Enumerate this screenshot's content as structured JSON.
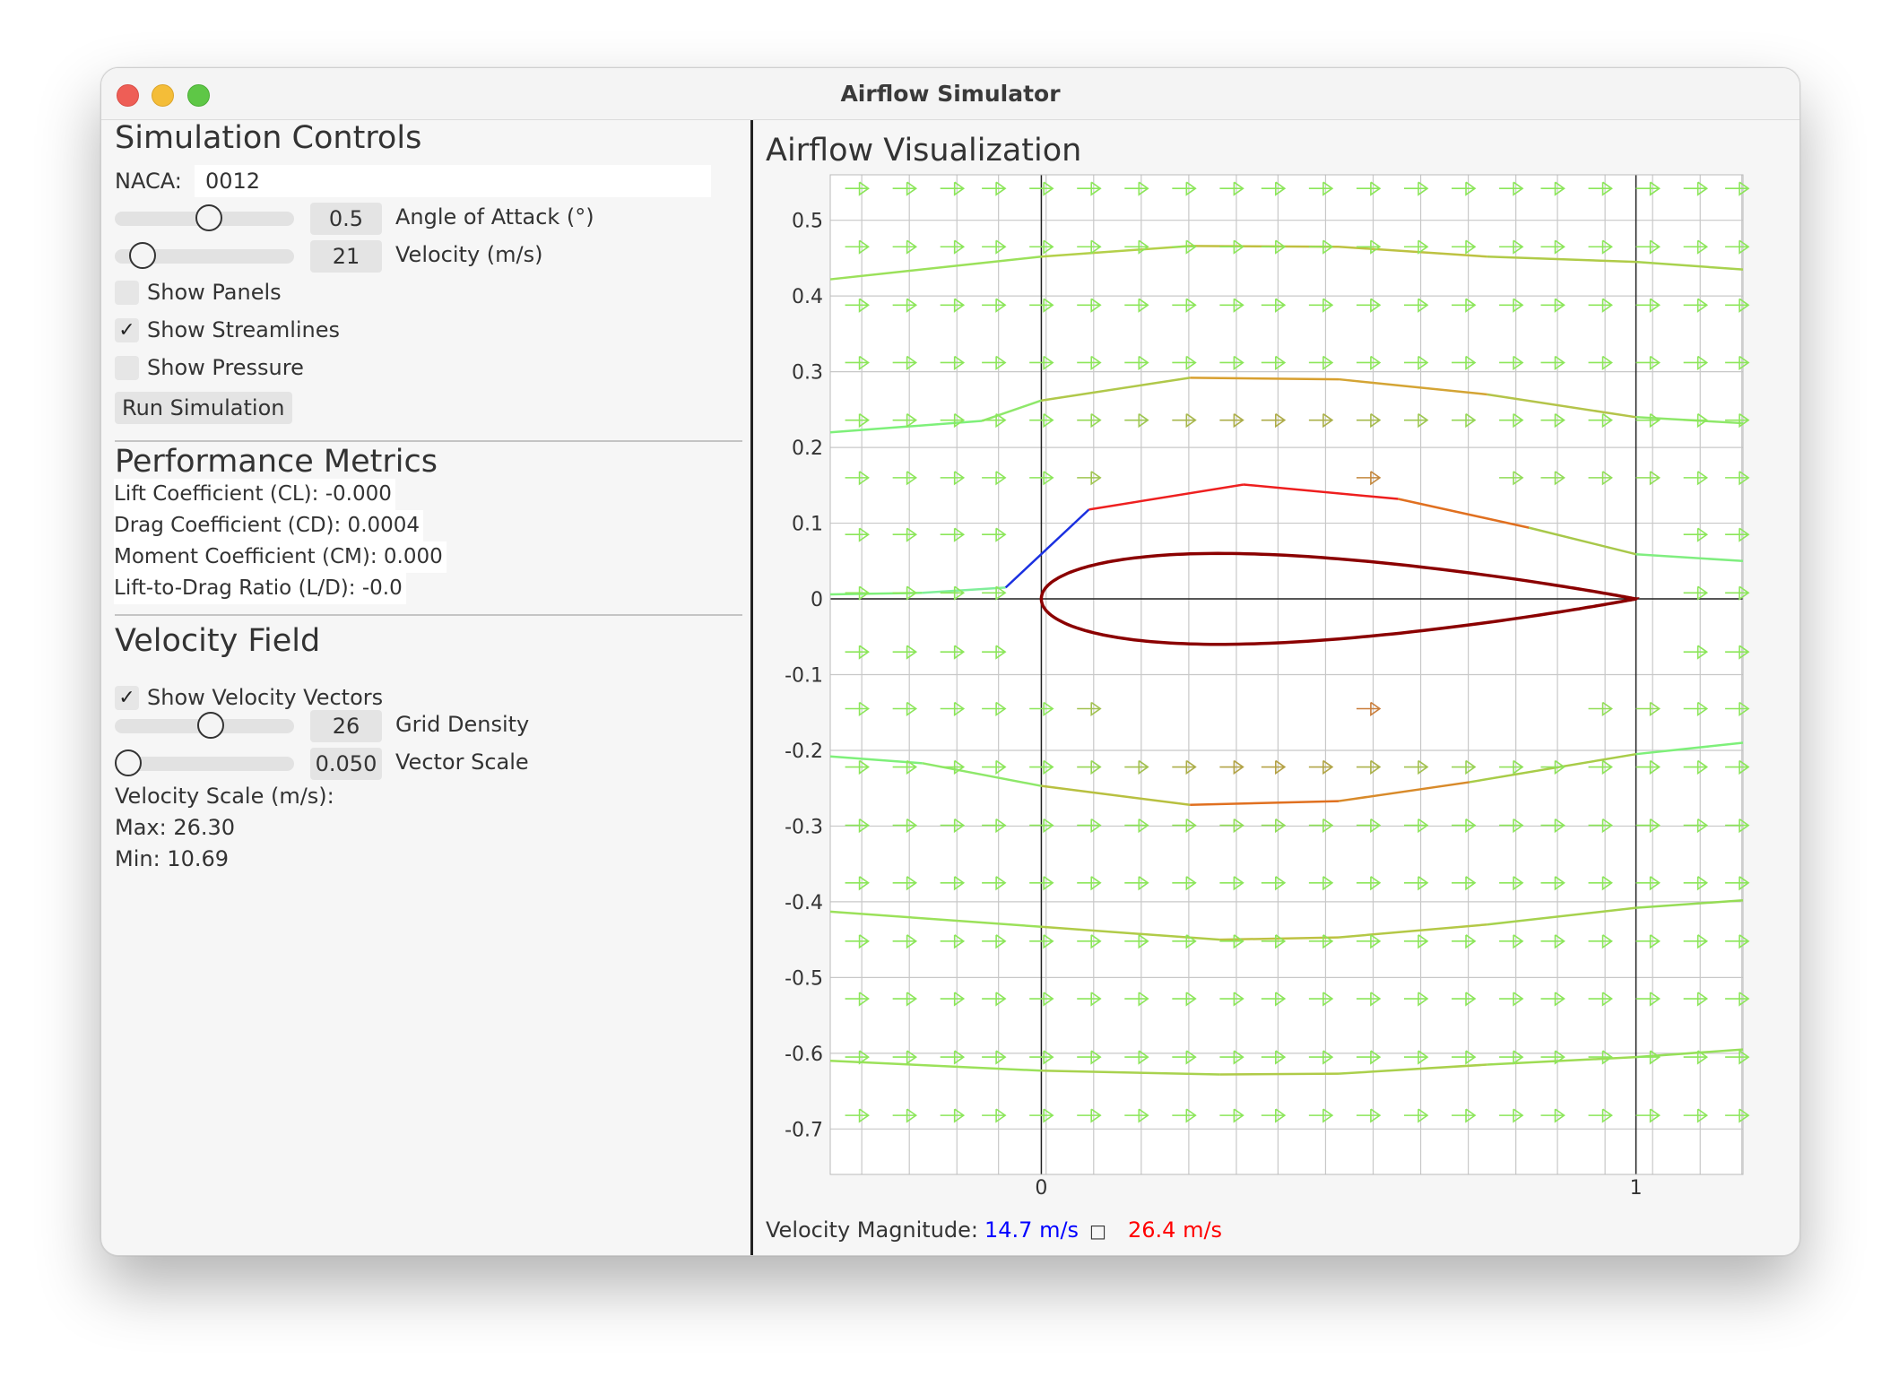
{
  "window": {
    "title": "Airflow Simulator"
  },
  "controls": {
    "heading": "Simulation Controls",
    "naca_label": "NACA:",
    "naca_value": "0012",
    "aoa": {
      "value": "0.5",
      "label": "Angle of Attack (°)",
      "slider_fraction": 0.52
    },
    "velocity": {
      "value": "21",
      "label": "Velocity (m/s)",
      "slider_fraction": 0.16
    },
    "show_panels": {
      "label": "Show Panels",
      "checked": false,
      "mark": ""
    },
    "show_streamlines": {
      "label": "Show Streamlines",
      "checked": true,
      "mark": "✓"
    },
    "show_pressure": {
      "label": "Show Pressure",
      "checked": false,
      "mark": ""
    },
    "run_button": "Run Simulation"
  },
  "metrics": {
    "heading": "Performance Metrics",
    "lift": "Lift Coefficient (CL): -0.000",
    "drag": "Drag Coefficient (CD): 0.0004",
    "moment": "Moment Coefficient (CM): 0.000",
    "ld": "Lift-to-Drag Ratio (L/D): -0.0"
  },
  "velocity_field": {
    "heading": "Velocity Field",
    "show_vectors": {
      "label": "Show Velocity Vectors",
      "checked": true,
      "mark": "✓"
    },
    "grid_density": {
      "value": "26",
      "label": "Grid Density",
      "slider_fraction": 0.53
    },
    "vector_scale": {
      "value": "0.050",
      "label": "Vector Scale",
      "slider_fraction": 0.0
    },
    "scale_label": "Velocity Scale (m/s):",
    "max": "Max: 26.30",
    "min": "Min: 10.69"
  },
  "visualization": {
    "heading": "Airflow Visualization",
    "legend_label": "Velocity Magnitude:",
    "legend_low": "14.7 m/s",
    "legend_square": "□",
    "legend_high": "26.4 m/s",
    "colors": {
      "low": "#0000ff",
      "high": "#ff0000",
      "airfoil": "#8b0000"
    }
  },
  "chart_data": {
    "type": "line",
    "title": "",
    "xlabel": "",
    "ylabel": "",
    "xlim": [
      -0.355,
      1.18
    ],
    "ylim": [
      -0.76,
      0.56
    ],
    "x_ticks": [
      0,
      1
    ],
    "x_tick_labels": [
      "0",
      "1"
    ],
    "y_ticks": [
      0.5,
      0.4,
      0.3,
      0.2,
      0.1,
      0,
      -0.1,
      -0.2,
      -0.3,
      -0.4,
      -0.5,
      -0.6,
      -0.7
    ],
    "y_tick_labels": [
      "0.5",
      "0.4",
      "0.3",
      "0.2",
      "0.1",
      "0",
      "-0.1",
      "-0.2",
      "-0.3",
      "-0.4",
      "-0.5",
      "-0.6",
      "-0.7"
    ],
    "grid": true,
    "airfoil": {
      "name": "NACA 0012",
      "chord": 1,
      "thickness": 0.12
    },
    "streamlines": [
      {
        "points": [
          [
            -0.355,
            0.422
          ],
          [
            0,
            0.452
          ],
          [
            0.25,
            0.466
          ],
          [
            0.5,
            0.465
          ],
          [
            0.75,
            0.452
          ],
          [
            1.0,
            0.445
          ],
          [
            1.18,
            0.435
          ]
        ],
        "colors": [
          "#9be15a",
          "#b4d04a",
          "#c0c040",
          "#bdc242",
          "#b0cb48",
          "#a8d24e"
        ]
      },
      {
        "points": [
          [
            -0.355,
            0.22
          ],
          [
            -0.1,
            0.235
          ],
          [
            0,
            0.262
          ],
          [
            0.25,
            0.292
          ],
          [
            0.5,
            0.29
          ],
          [
            0.75,
            0.27
          ],
          [
            1.0,
            0.24
          ],
          [
            1.18,
            0.232
          ]
        ],
        "colors": [
          "#7ef07a",
          "#8ee86a",
          "#b0c84a",
          "#d8a030",
          "#d4a434",
          "#b4c44a",
          "#8ee86a"
        ]
      },
      {
        "points": [
          [
            -0.355,
            0.006
          ],
          [
            -0.2,
            0.008
          ],
          [
            -0.06,
            0.015
          ],
          [
            0.08,
            0.118
          ],
          [
            0.34,
            0.151
          ],
          [
            0.6,
            0.132
          ],
          [
            0.82,
            0.094
          ],
          [
            1.0,
            0.059
          ],
          [
            1.18,
            0.05
          ]
        ],
        "colors": [
          "#7ef07a",
          "#80ee9a",
          "#1a30e0",
          "#ee2020",
          "#ee1e1e",
          "#e07020",
          "#a8c84a",
          "#80ee80"
        ]
      },
      {
        "points": [
          [
            -0.355,
            -0.208
          ],
          [
            -0.2,
            -0.217
          ],
          [
            0,
            -0.247
          ],
          [
            0.25,
            -0.272
          ],
          [
            0.5,
            -0.267
          ],
          [
            0.72,
            -0.242
          ],
          [
            1.0,
            -0.205
          ],
          [
            1.18,
            -0.19
          ]
        ],
        "colors": [
          "#7ef07a",
          "#8ee86a",
          "#b8c040",
          "#e07020",
          "#d88a2a",
          "#a8cc48",
          "#7ef07a"
        ]
      },
      {
        "points": [
          [
            -0.355,
            -0.413
          ],
          [
            0,
            -0.433
          ],
          [
            0.3,
            -0.45
          ],
          [
            0.5,
            -0.447
          ],
          [
            0.75,
            -0.43
          ],
          [
            1.0,
            -0.408
          ],
          [
            1.18,
            -0.398
          ]
        ],
        "colors": [
          "#9be15a",
          "#b0cb48",
          "#bec242",
          "#b4c846",
          "#a6d24e",
          "#96dc56"
        ]
      },
      {
        "points": [
          [
            -0.355,
            -0.61
          ],
          [
            0,
            -0.623
          ],
          [
            0.3,
            -0.628
          ],
          [
            0.5,
            -0.627
          ],
          [
            0.75,
            -0.615
          ],
          [
            1.0,
            -0.605
          ],
          [
            1.18,
            -0.595
          ]
        ],
        "colors": [
          "#9be15a",
          "#a8d24e",
          "#b0cb48",
          "#aad04c",
          "#9edc54",
          "#96e05a"
        ]
      }
    ],
    "vectors": {
      "x": [
        -0.33,
        -0.25,
        -0.17,
        -0.1,
        -0.02,
        0.06,
        0.14,
        0.22,
        0.3,
        0.37,
        0.45,
        0.53,
        0.61,
        0.69,
        0.77,
        0.84,
        0.92,
        1.0,
        1.08,
        1.15
      ],
      "y": [
        0.542,
        0.465,
        0.388,
        0.312,
        0.236,
        0.16,
        0.085,
        0.008,
        -0.07,
        -0.145,
        -0.222,
        -0.299,
        -0.375,
        -0.452,
        -0.528,
        -0.605,
        -0.682
      ]
    }
  }
}
